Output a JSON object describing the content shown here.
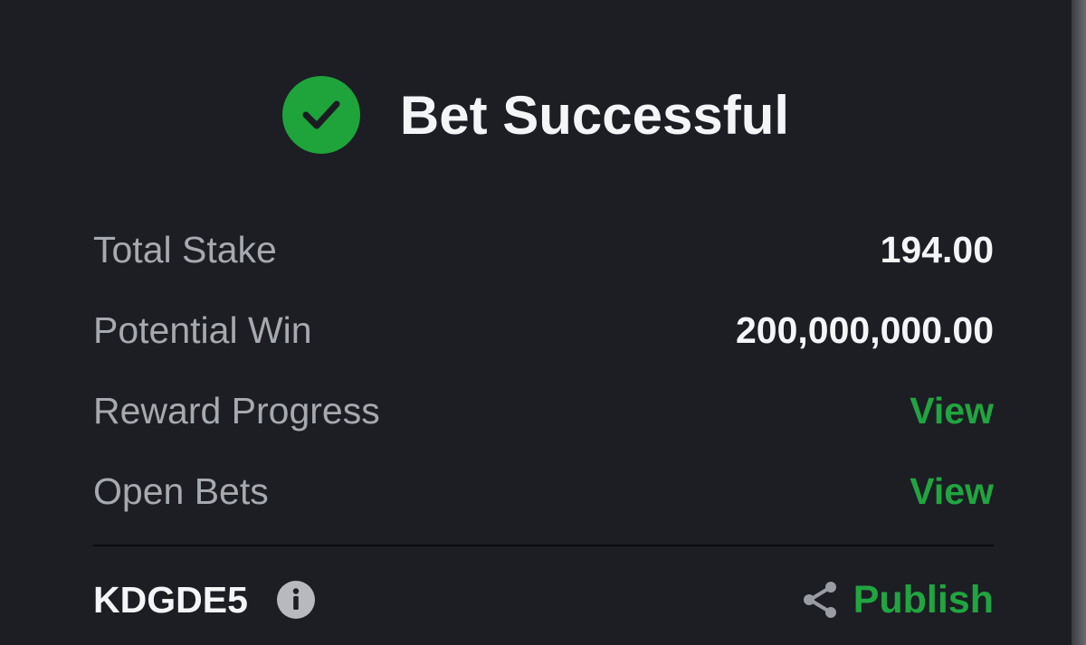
{
  "header": {
    "icon": "check-circle-icon",
    "title": "Bet Successful"
  },
  "summary": {
    "rows": [
      {
        "label": "Total Stake",
        "value": "194.00"
      },
      {
        "label": "Potential Win",
        "value": "200,000,000.00"
      },
      {
        "label": "Reward Progress",
        "link": "View"
      },
      {
        "label": "Open Bets",
        "link": "View"
      }
    ]
  },
  "footer": {
    "booking_code": "KDGDE5",
    "info_icon": "info-icon",
    "share_icon": "share-icon",
    "publish_label": "Publish"
  },
  "colors": {
    "background": "#1c1e24",
    "accent_green": "#21a540",
    "label_gray": "#a7a9b0",
    "value_white": "#f4f5f7"
  }
}
